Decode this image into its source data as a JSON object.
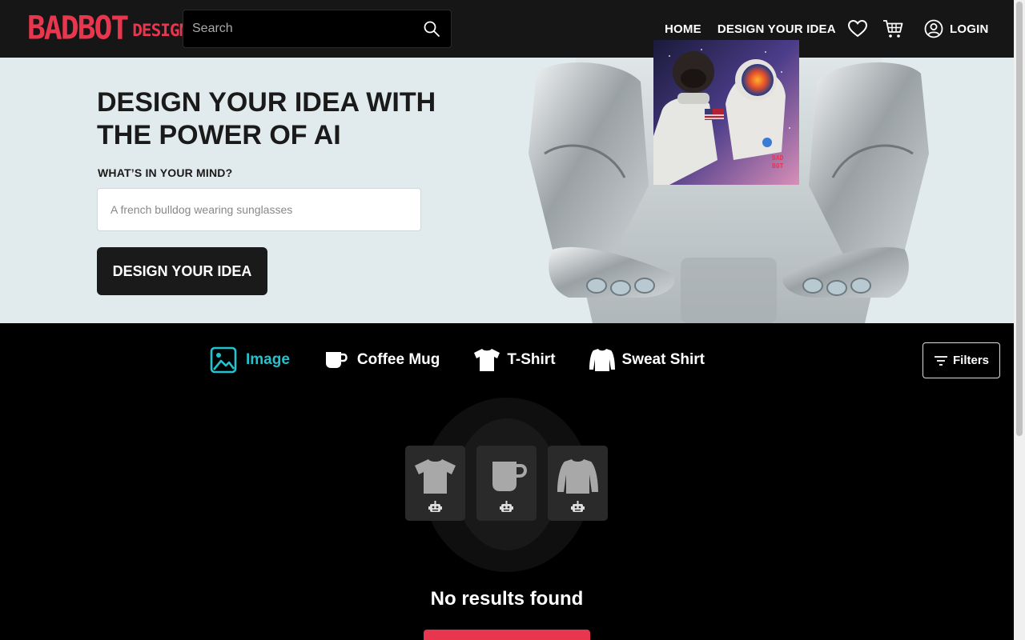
{
  "header": {
    "logo_main": "BADBOT",
    "logo_sub": "DESIGN",
    "search_placeholder": "Search",
    "nav": {
      "home": "HOME",
      "design": "DESIGN YOUR IDEA",
      "login": "LOGIN"
    }
  },
  "hero": {
    "title": "DESIGN YOUR IDEA WITH THE POWER OF AI",
    "label": "WHAT’S IN YOUR MIND?",
    "input_placeholder": "A french bulldog wearing sunglasses",
    "button": "DESIGN YOUR IDEA"
  },
  "tabs": [
    {
      "label": "Image",
      "icon": "image-icon",
      "active": true
    },
    {
      "label": "Coffee Mug",
      "icon": "mug-icon",
      "active": false
    },
    {
      "label": "T-Shirt",
      "icon": "tshirt-icon",
      "active": false
    },
    {
      "label": "Sweat Shirt",
      "icon": "sweatshirt-icon",
      "active": false
    }
  ],
  "filters_label": "Filters",
  "empty_state": {
    "message": "No results found"
  },
  "colors": {
    "brand": "#e8364f",
    "accent": "#22c3cf",
    "header_bg": "#161616",
    "hero_bg": "#e1eaec"
  }
}
